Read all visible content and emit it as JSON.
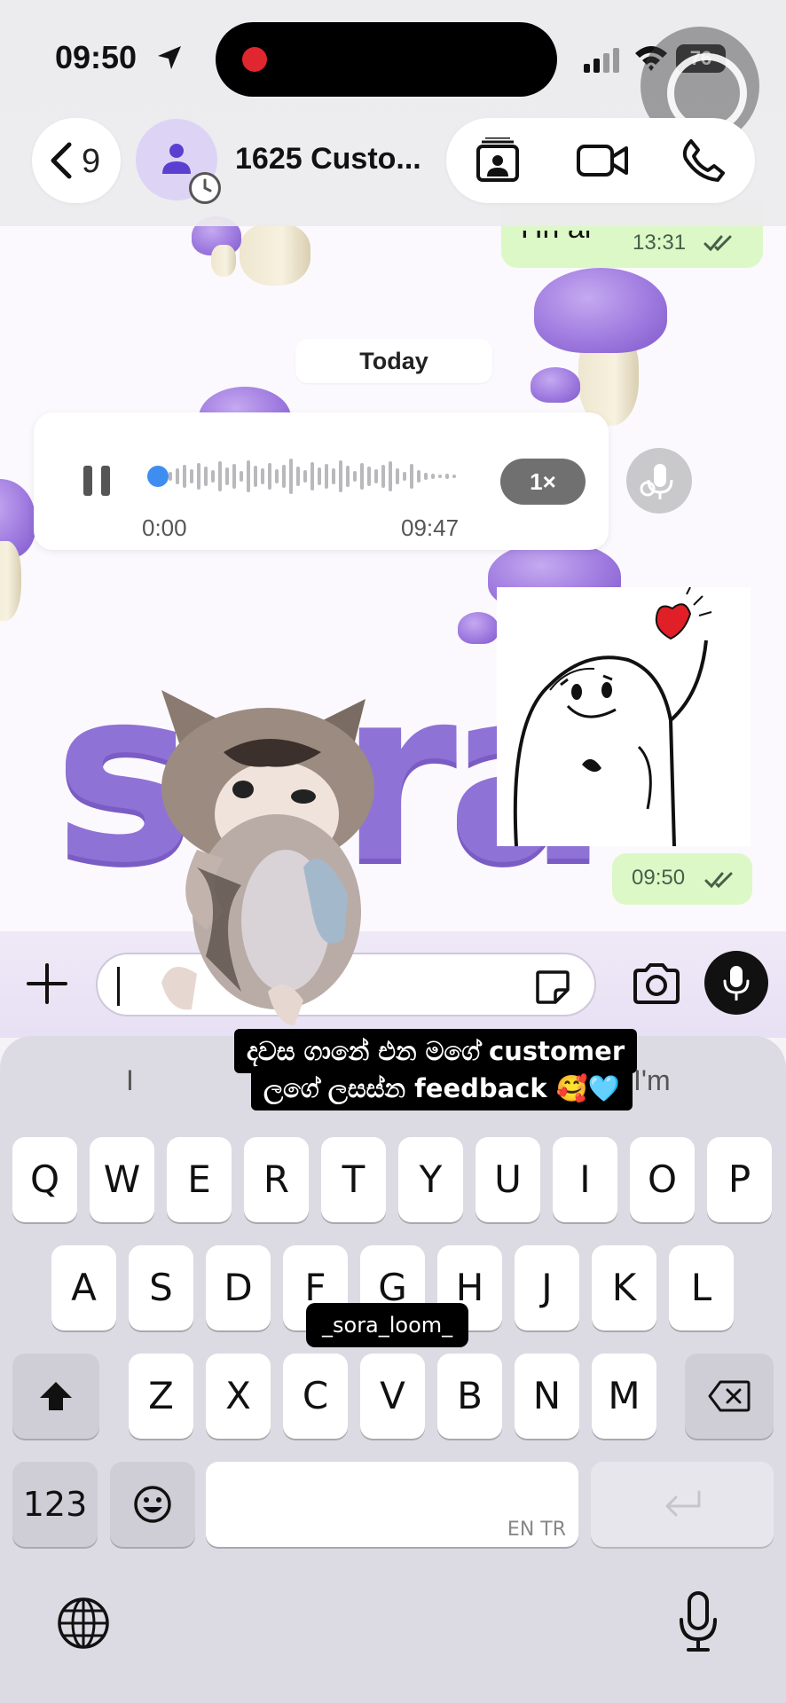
{
  "status_bar": {
    "time": "09:50",
    "battery": "76"
  },
  "header": {
    "back_count": "9",
    "contact_name": "1625 Custo..."
  },
  "messages": {
    "partial_text": "Hri ar",
    "partial_time": "13:31",
    "date_separator": "Today",
    "voice": {
      "current": "0:00",
      "duration": "09:47",
      "speed": "1×",
      "progress": 0.0
    },
    "sticker_time": "09:50"
  },
  "wallpaper": {
    "brand_text": "sora"
  },
  "keyboard": {
    "suggestions": [
      "I",
      "I'm"
    ],
    "row1": [
      "Q",
      "W",
      "E",
      "R",
      "T",
      "Y",
      "U",
      "I",
      "O",
      "P"
    ],
    "row2": [
      "A",
      "S",
      "D",
      "F",
      "G",
      "H",
      "J",
      "K",
      "L"
    ],
    "row3": [
      "Z",
      "X",
      "C",
      "V",
      "B",
      "N",
      "M"
    ],
    "numbers_key": "123",
    "space_languages": "EN TR"
  },
  "overlay": {
    "caption_line1": "දවස ගානේ එන මගේ customer",
    "caption_line2": "ලගේ ලසස්න feedback 🥰🩵",
    "watermark": "_sora_loom_"
  },
  "colors": {
    "outgoing_bubble": "#dcf8c6",
    "accent_purple": "#8f72d6",
    "recording_red": "#e0262f"
  }
}
